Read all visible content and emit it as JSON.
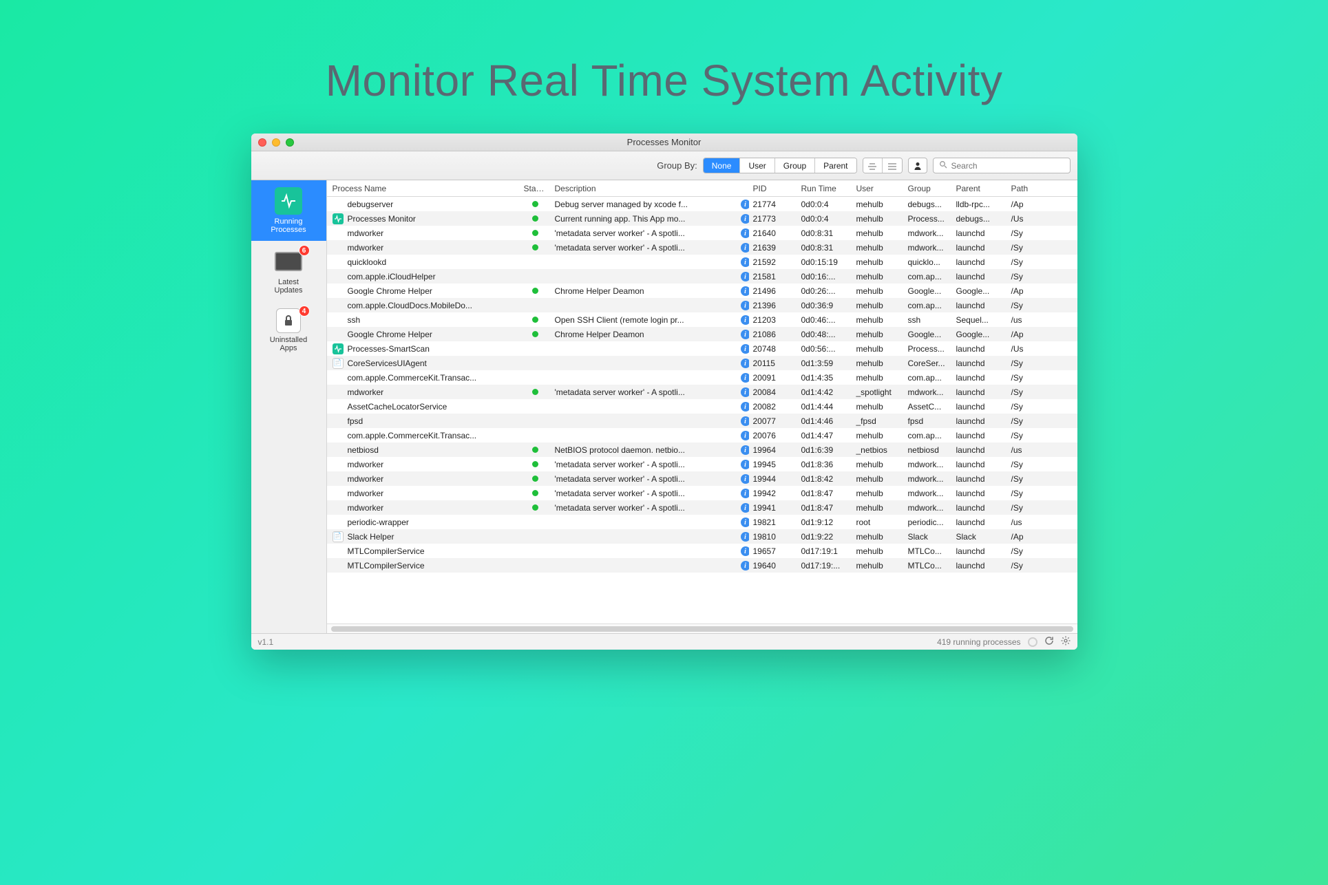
{
  "hero": {
    "title": "Monitor Real Time System Activity"
  },
  "window": {
    "title": "Processes Monitor"
  },
  "toolbar": {
    "group_by_label": "Group By:",
    "segments": {
      "none": "None",
      "user": "User",
      "group": "Group",
      "parent": "Parent"
    },
    "search_placeholder": "Search"
  },
  "sidebar": {
    "items": [
      {
        "label": "Running Processes",
        "selected": true,
        "icon": "activity"
      },
      {
        "label": "Latest Updates",
        "icon": "laptop",
        "badge": "6"
      },
      {
        "label": "Uninstalled Apps",
        "icon": "lock",
        "badge": "4"
      }
    ]
  },
  "table": {
    "columns": {
      "name": "Process Name",
      "status": "Status",
      "desc": "Description",
      "pid": "PID",
      "run": "Run Time",
      "user": "User",
      "group": "Group",
      "parent": "Parent",
      "path": "Path"
    },
    "rows": [
      {
        "icon": "",
        "name": "debugserver",
        "status": true,
        "desc": "Debug server managed by xcode f...",
        "pid": "21774",
        "run": "0d0:0:4",
        "user": "mehulb",
        "group": "debugs...",
        "parent": "lldb-rpc...",
        "path": "/Ap"
      },
      {
        "icon": "activity",
        "name": "Processes Monitor",
        "status": true,
        "desc": "Current running app. This App mo...",
        "pid": "21773",
        "run": "0d0:0:4",
        "user": "mehulb",
        "group": "Process...",
        "parent": "debugs...",
        "path": "/Us"
      },
      {
        "icon": "",
        "name": "mdworker",
        "status": true,
        "desc": "'metadata server worker' - A spotli...",
        "pid": "21640",
        "run": "0d0:8:31",
        "user": "mehulb",
        "group": "mdwork...",
        "parent": "launchd",
        "path": "/Sy"
      },
      {
        "icon": "",
        "name": "mdworker",
        "status": true,
        "desc": "'metadata server worker' - A spotli...",
        "pid": "21639",
        "run": "0d0:8:31",
        "user": "mehulb",
        "group": "mdwork...",
        "parent": "launchd",
        "path": "/Sy"
      },
      {
        "icon": "",
        "name": "quicklookd",
        "status": false,
        "desc": "",
        "pid": "21592",
        "run": "0d0:15:19",
        "user": "mehulb",
        "group": "quicklo...",
        "parent": "launchd",
        "path": "/Sy"
      },
      {
        "icon": "",
        "name": "com.apple.iCloudHelper",
        "status": false,
        "desc": "",
        "pid": "21581",
        "run": "0d0:16:...",
        "user": "mehulb",
        "group": "com.ap...",
        "parent": "launchd",
        "path": "/Sy"
      },
      {
        "icon": "",
        "name": "Google Chrome Helper",
        "status": true,
        "desc": "Chrome Helper Deamon",
        "pid": "21496",
        "run": "0d0:26:...",
        "user": "mehulb",
        "group": "Google...",
        "parent": "Google...",
        "path": "/Ap"
      },
      {
        "icon": "",
        "name": "com.apple.CloudDocs.MobileDo...",
        "status": false,
        "desc": "",
        "pid": "21396",
        "run": "0d0:36:9",
        "user": "mehulb",
        "group": "com.ap...",
        "parent": "launchd",
        "path": "/Sy"
      },
      {
        "icon": "",
        "name": "ssh",
        "status": true,
        "desc": "Open SSH Client (remote login pr...",
        "pid": "21203",
        "run": "0d0:46:...",
        "user": "mehulb",
        "group": "ssh",
        "parent": "Sequel...",
        "path": "/us"
      },
      {
        "icon": "",
        "name": "Google Chrome Helper",
        "status": true,
        "desc": "Chrome Helper Deamon",
        "pid": "21086",
        "run": "0d0:48:...",
        "user": "mehulb",
        "group": "Google...",
        "parent": "Google...",
        "path": "/Ap"
      },
      {
        "icon": "activity",
        "name": "Processes-SmartScan",
        "status": false,
        "desc": "",
        "pid": "20748",
        "run": "0d0:56:...",
        "user": "mehulb",
        "group": "Process...",
        "parent": "launchd",
        "path": "/Us"
      },
      {
        "icon": "doc",
        "name": "CoreServicesUIAgent",
        "status": false,
        "desc": "",
        "pid": "20115",
        "run": "0d1:3:59",
        "user": "mehulb",
        "group": "CoreSer...",
        "parent": "launchd",
        "path": "/Sy"
      },
      {
        "icon": "",
        "name": "com.apple.CommerceKit.Transac...",
        "status": false,
        "desc": "",
        "pid": "20091",
        "run": "0d1:4:35",
        "user": "mehulb",
        "group": "com.ap...",
        "parent": "launchd",
        "path": "/Sy"
      },
      {
        "icon": "",
        "name": "mdworker",
        "status": true,
        "desc": "'metadata server worker' - A spotli...",
        "pid": "20084",
        "run": "0d1:4:42",
        "user": "_spotlight",
        "group": "mdwork...",
        "parent": "launchd",
        "path": "/Sy"
      },
      {
        "icon": "",
        "name": "AssetCacheLocatorService",
        "status": false,
        "desc": "",
        "pid": "20082",
        "run": "0d1:4:44",
        "user": "mehulb",
        "group": "AssetC...",
        "parent": "launchd",
        "path": "/Sy"
      },
      {
        "icon": "",
        "name": "fpsd",
        "status": false,
        "desc": "",
        "pid": "20077",
        "run": "0d1:4:46",
        "user": "_fpsd",
        "group": "fpsd",
        "parent": "launchd",
        "path": "/Sy"
      },
      {
        "icon": "",
        "name": "com.apple.CommerceKit.Transac...",
        "status": false,
        "desc": "",
        "pid": "20076",
        "run": "0d1:4:47",
        "user": "mehulb",
        "group": "com.ap...",
        "parent": "launchd",
        "path": "/Sy"
      },
      {
        "icon": "",
        "name": "netbiosd",
        "status": true,
        "desc": "NetBIOS protocol daemon. netbio...",
        "pid": "19964",
        "run": "0d1:6:39",
        "user": "_netbios",
        "group": "netbiosd",
        "parent": "launchd",
        "path": "/us"
      },
      {
        "icon": "",
        "name": "mdworker",
        "status": true,
        "desc": "'metadata server worker' - A spotli...",
        "pid": "19945",
        "run": "0d1:8:36",
        "user": "mehulb",
        "group": "mdwork...",
        "parent": "launchd",
        "path": "/Sy"
      },
      {
        "icon": "",
        "name": "mdworker",
        "status": true,
        "desc": "'metadata server worker' - A spotli...",
        "pid": "19944",
        "run": "0d1:8:42",
        "user": "mehulb",
        "group": "mdwork...",
        "parent": "launchd",
        "path": "/Sy"
      },
      {
        "icon": "",
        "name": "mdworker",
        "status": true,
        "desc": "'metadata server worker' - A spotli...",
        "pid": "19942",
        "run": "0d1:8:47",
        "user": "mehulb",
        "group": "mdwork...",
        "parent": "launchd",
        "path": "/Sy"
      },
      {
        "icon": "",
        "name": "mdworker",
        "status": true,
        "desc": "'metadata server worker' - A spotli...",
        "pid": "19941",
        "run": "0d1:8:47",
        "user": "mehulb",
        "group": "mdwork...",
        "parent": "launchd",
        "path": "/Sy"
      },
      {
        "icon": "",
        "name": "periodic-wrapper",
        "status": false,
        "desc": "",
        "pid": "19821",
        "run": "0d1:9:12",
        "user": "root",
        "group": "periodic...",
        "parent": "launchd",
        "path": "/us"
      },
      {
        "icon": "doc",
        "name": "Slack Helper",
        "status": false,
        "desc": "",
        "pid": "19810",
        "run": "0d1:9:22",
        "user": "mehulb",
        "group": "Slack",
        "parent": "Slack",
        "path": "/Ap"
      },
      {
        "icon": "",
        "name": "MTLCompilerService",
        "status": false,
        "desc": "",
        "pid": "19657",
        "run": "0d17:19:1",
        "user": "mehulb",
        "group": "MTLCo...",
        "parent": "launchd",
        "path": "/Sy"
      },
      {
        "icon": "",
        "name": "MTLCompilerService",
        "status": false,
        "desc": "",
        "pid": "19640",
        "run": "0d17:19:...",
        "user": "mehulb",
        "group": "MTLCo...",
        "parent": "launchd",
        "path": "/Sy"
      }
    ]
  },
  "statusbar": {
    "version": "v1.1",
    "count": "419 running processes"
  }
}
